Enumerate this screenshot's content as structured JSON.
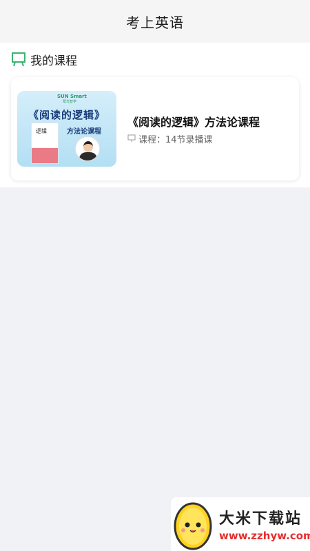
{
  "header": {
    "title": "考上英语"
  },
  "section": {
    "title": "我的课程",
    "icon": "presentation-board-icon"
  },
  "course": {
    "name": "《阅读的逻辑》方法论课程",
    "meta": "课程：14节录播课",
    "meta_icon": "screen-icon",
    "thumbnail": {
      "logo": "SUN Smart",
      "logo_sub": "阳光智学",
      "title": "《阅读的逻辑》",
      "subtitle": "方法论课程",
      "book_char": "逻辑"
    }
  },
  "watermark": {
    "title": "大米下载站",
    "url": "www.zzhyw.com"
  },
  "colors": {
    "accent_green": "#3cb371",
    "watermark_red": "#e62e2e",
    "thumb_blue": "#1a3c7a"
  }
}
